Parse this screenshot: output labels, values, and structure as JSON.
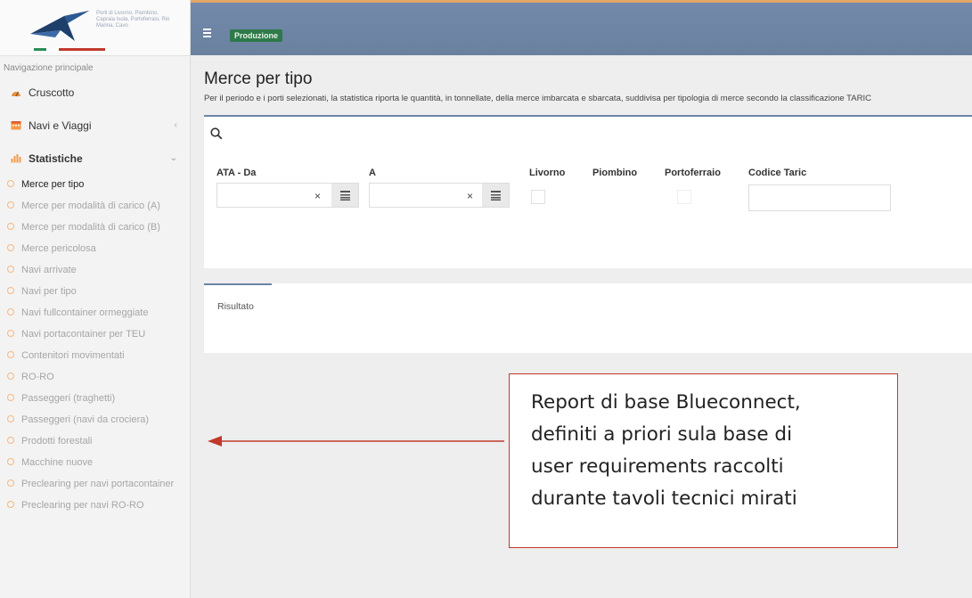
{
  "brand": {
    "logo_text": "Porti di Livorno, Piombino, Capraia Isola, Portoferraio, Rio Marina, Cavo",
    "flag_colors": [
      "#2e8b57",
      "#ffffff",
      "#c0392b"
    ]
  },
  "sidebar": {
    "heading": "Navigazione principale",
    "main_items": [
      {
        "label": "Cruscotto",
        "icon": "dashboard-icon"
      },
      {
        "label": "Navi e Viaggi",
        "icon": "calendar-icon",
        "chevron": "‹"
      },
      {
        "label": "Statistiche",
        "icon": "bar-chart-icon",
        "chevron": "⌄"
      }
    ],
    "sub_items": [
      "Merce per tipo",
      "Merce per modalità di carico (A)",
      "Merce per modalità di carico (B)",
      "Merce pericolosa",
      "Navi arrivate",
      "Navi per tipo",
      "Navi fullcontainer ormeggiate",
      "Navi portacontainer per TEU",
      "Contenitori movimentati",
      "RO-RO",
      "Passeggeri (traghetti)",
      "Passeggeri (navi da crociera)",
      "Prodotti forestali",
      "Macchine nuove",
      "Preclearing per navi portacontainer",
      "Preclearing per navi RO-RO"
    ],
    "active_index": 0
  },
  "topbar": {
    "badge": "Produzione",
    "accent": "#6f86a8",
    "top_stripe": "#e2a766"
  },
  "main": {
    "title": "Merce per tipo",
    "description": "Per il periodo e i porti selezionati, la statistica riporta le quantità, in tonnellate, della merce imbarcata e sbarcata, suddivisa per tipologia di merce secondo la classificazione TARIC",
    "filters": {
      "date_from_label": "ATA - Da",
      "date_to_label": "A",
      "ports": [
        "Livorno",
        "Piombino",
        "Portoferraio"
      ],
      "taric_label": "Codice Taric",
      "clear_glyph": "×"
    },
    "results_label": "Risultato"
  },
  "annotation": {
    "lines": [
      "Report di base Blueconnect,",
      "definiti a priori sula base di",
      "user requirements raccolti",
      "durante tavoli tecnici mirati"
    ],
    "color": "#c0392b"
  }
}
